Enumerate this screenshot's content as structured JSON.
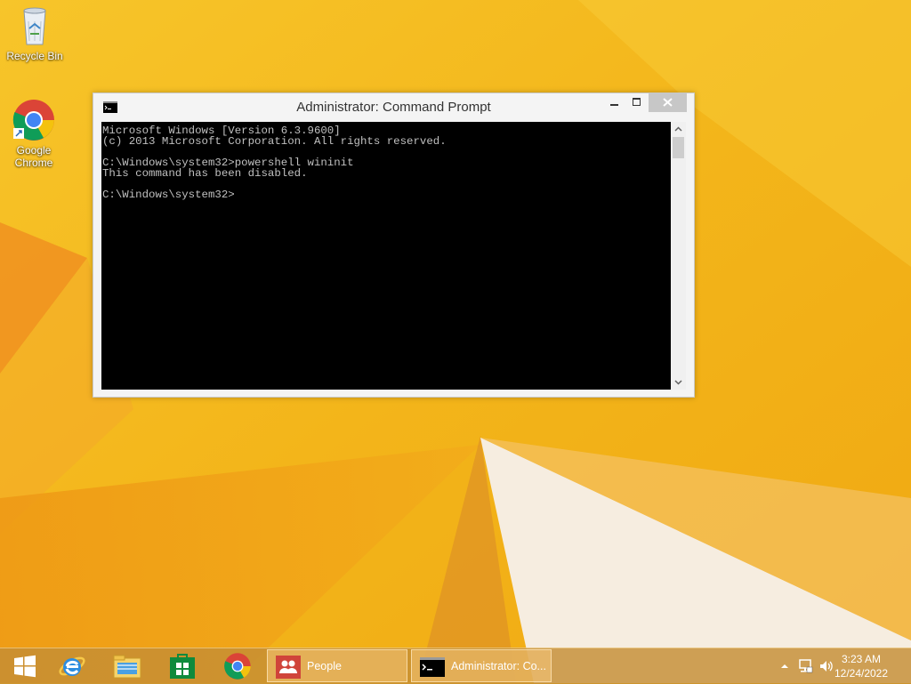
{
  "desktop": {
    "icons": [
      {
        "label": "Recycle Bin",
        "icon": "recycle-bin-icon"
      },
      {
        "label": "Google\nChrome",
        "icon": "chrome-icon"
      }
    ]
  },
  "window": {
    "title": "Administrator: Command Prompt",
    "icon": "cmd-icon",
    "console_lines": [
      "Microsoft Windows [Version 6.3.9600]",
      "(c) 2013 Microsoft Corporation. All rights reserved.",
      "",
      "C:\\Windows\\system32>powershell wininit",
      "This command has been disabled.",
      "",
      "C:\\Windows\\system32>"
    ]
  },
  "taskbar": {
    "pinned": [
      {
        "icon": "start-icon"
      },
      {
        "icon": "internet-explorer-icon"
      },
      {
        "icon": "file-explorer-icon"
      },
      {
        "icon": "store-icon"
      },
      {
        "icon": "chrome-icon"
      }
    ],
    "tasks": [
      {
        "label": "People",
        "icon": "people-icon"
      },
      {
        "label": "Administrator: Co...",
        "icon": "cmd-icon"
      }
    ],
    "tray": {
      "icons": [
        "show-hidden-icons-icon",
        "network-icon",
        "volume-icon"
      ],
      "time": "3:23 AM",
      "date": "12/24/2022"
    }
  },
  "colors": {
    "wallpaper": "#f2b418",
    "console_bg": "#000000",
    "console_fg": "#c0c0c0",
    "people_tile": "#d0443a"
  }
}
